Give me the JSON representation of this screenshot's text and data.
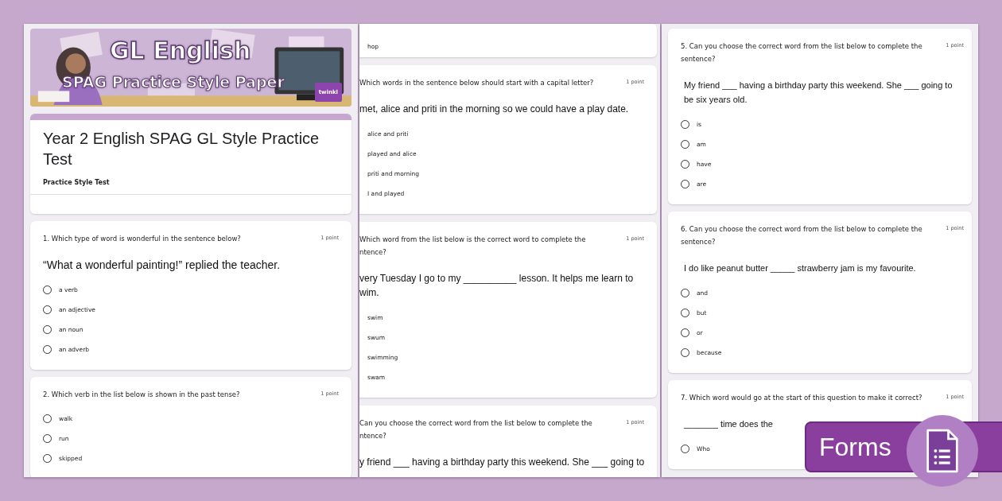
{
  "columns": [
    {
      "cut_left": false,
      "cards": [
        {
          "kind": "banner",
          "title": "GL English",
          "subtitle": "SPAG Practice Style Paper",
          "logo": "twinkl"
        },
        {
          "kind": "title",
          "title": "Year 2 English SPAG GL Style Practice Test",
          "description": "Practice Style Test"
        },
        {
          "kind": "question",
          "question": [
            "1. Which type of word is wonderful in the sentence below?"
          ],
          "points": "1 point",
          "sentence": [
            "“What a wonderful painting!” replied the teacher."
          ],
          "options": [
            {
              "label": "a verb",
              "selected": false
            },
            {
              "label": "an adjective",
              "selected": false
            },
            {
              "label": "an noun",
              "selected": false
            },
            {
              "label": "an adverb",
              "selected": false
            }
          ]
        },
        {
          "kind": "question",
          "question": [
            "2. Which verb in the list below is shown in the past tense?"
          ],
          "points": "1 point",
          "options": [
            {
              "label": "walk",
              "selected": false
            },
            {
              "label": "run",
              "selected": false
            },
            {
              "label": "skipped",
              "selected": false
            }
          ]
        }
      ]
    },
    {
      "cut_left": true,
      "cards": [
        {
          "kind": "tail",
          "options": [
            "hop"
          ]
        },
        {
          "kind": "question",
          "question": [
            "Which words in the sentence below should start with a capital letter?"
          ],
          "points": "1 point",
          "sentence": [
            "met, alice and priti in the morning so we could have a play date."
          ],
          "options": [
            "alice and priti",
            "played and alice",
            "priti and morning",
            "I and played"
          ]
        },
        {
          "kind": "question",
          "question": [
            "Which word from the list below is the correct word to complete the",
            "ntence?"
          ],
          "points": "1 point",
          "sentence": [
            "very Tuesday I go to my __________ lesson. It helps me learn to",
            "wim."
          ],
          "options": [
            "swim",
            "swum",
            "swimming",
            "swam"
          ]
        },
        {
          "kind": "question",
          "question": [
            "Can you choose the correct word from the list below to complete the",
            "ntence?"
          ],
          "points": "1 point",
          "sentence": [
            "y friend ___ having a birthday party this weekend. She ___ going to"
          ]
        }
      ]
    },
    {
      "cut_left": false,
      "cards": [
        {
          "kind": "question",
          "question": [
            "5. Can you choose the correct word from the list below to complete the",
            "sentence?"
          ],
          "points": "1 point",
          "sentence": [
            "My friend ___ having a birthday party this weekend. She ___ going to",
            "be six years old."
          ],
          "options": [
            {
              "label": "is",
              "selected": false
            },
            {
              "label": "am",
              "selected": false
            },
            {
              "label": "have",
              "selected": false
            },
            {
              "label": "are",
              "selected": false
            }
          ]
        },
        {
          "kind": "question",
          "question": [
            "6. Can you choose the correct word from the list below to complete the",
            "sentence?"
          ],
          "points": "1 point",
          "sentence": [
            "I do like peanut butter _____ strawberry jam is my favourite."
          ],
          "options": [
            {
              "label": "and",
              "selected": false
            },
            {
              "label": "but",
              "selected": false
            },
            {
              "label": "or",
              "selected": false
            },
            {
              "label": "because",
              "selected": false
            }
          ]
        },
        {
          "kind": "question",
          "question": [
            "7. Which word would go at the start of this question to make it correct?"
          ],
          "points": "1 point",
          "sentence": [
            "_______ time does the"
          ],
          "options": [
            {
              "label": "Who",
              "selected": false
            }
          ]
        }
      ]
    }
  ],
  "badge": {
    "label": "Forms"
  }
}
